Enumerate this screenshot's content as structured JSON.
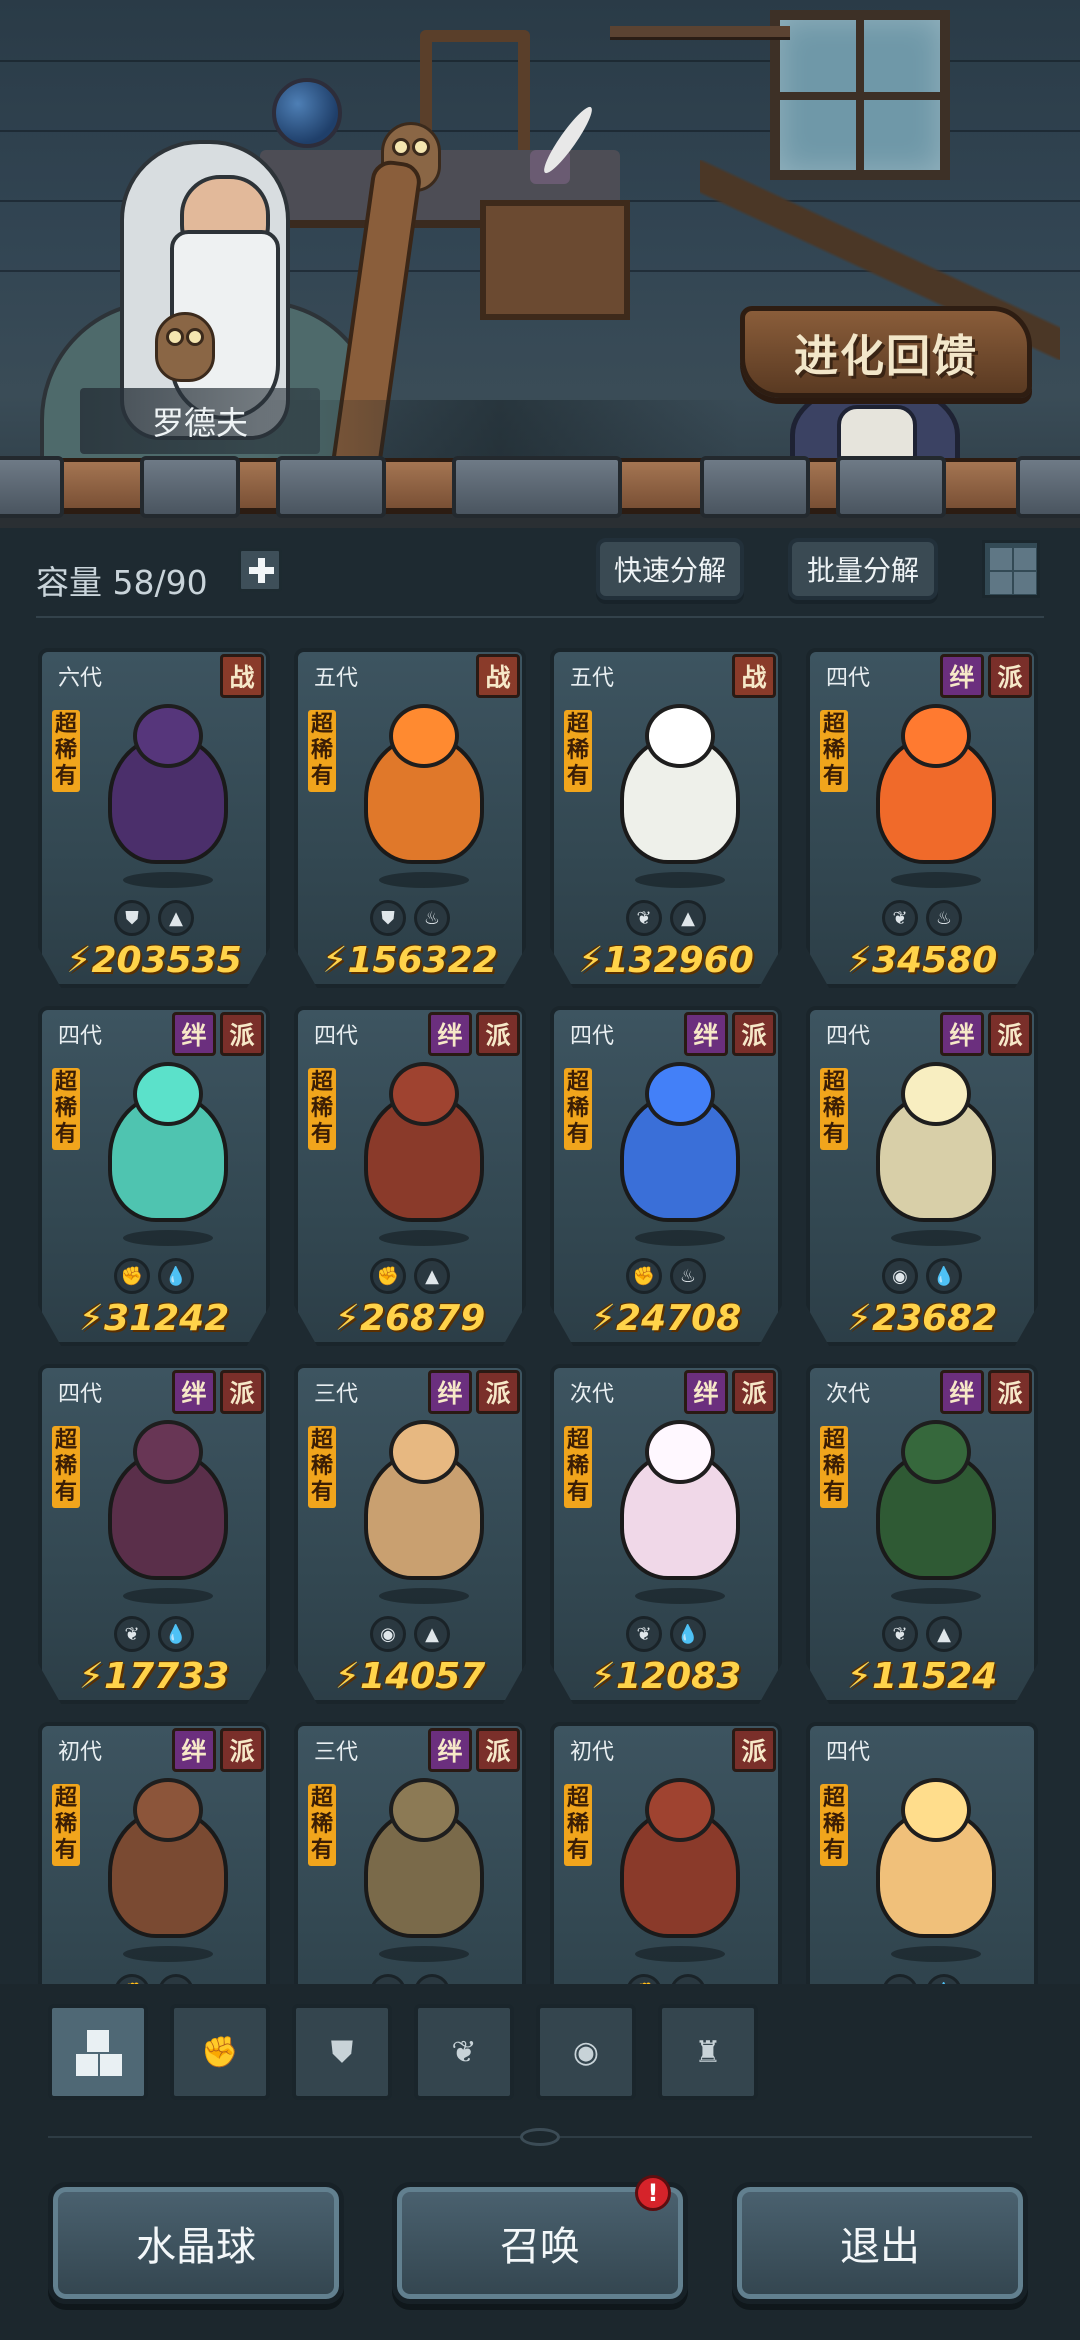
{
  "npc": {
    "name": "罗德夫"
  },
  "evolution_feedback": {
    "label": "进化回馈"
  },
  "inventory": {
    "capacity_label": "容量 58/90",
    "quick_decompose": "快速分解",
    "batch_decompose": "批量分解"
  },
  "rarity_text": [
    "超",
    "稀",
    "有"
  ],
  "cards": [
    {
      "gen": "六代",
      "tags": [
        "战"
      ],
      "power": "203535",
      "elements": [
        "shield-icon",
        "earth-icon"
      ],
      "color": "#4b2f6b"
    },
    {
      "gen": "五代",
      "tags": [
        "战"
      ],
      "power": "156322",
      "elements": [
        "shield-icon",
        "fire-icon"
      ],
      "color": "#e0782a"
    },
    {
      "gen": "五代",
      "tags": [
        "战"
      ],
      "power": "132960",
      "elements": [
        "sprout-icon",
        "earth-icon"
      ],
      "color": "#eef0ea"
    },
    {
      "gen": "四代",
      "tags": [
        "绊",
        "派"
      ],
      "power": "34580",
      "elements": [
        "sprout-icon",
        "fire-icon"
      ],
      "color": "#f06a2a"
    },
    {
      "gen": "四代",
      "tags": [
        "绊",
        "派"
      ],
      "power": "31242",
      "elements": [
        "fist-icon",
        "water-icon"
      ],
      "color": "#4fc4b0"
    },
    {
      "gen": "四代",
      "tags": [
        "绊",
        "派"
      ],
      "power": "26879",
      "elements": [
        "fist-icon",
        "earth-icon"
      ],
      "color": "#8a3a2a"
    },
    {
      "gen": "四代",
      "tags": [
        "绊",
        "派"
      ],
      "power": "24708",
      "elements": [
        "fist-icon",
        "fire-icon"
      ],
      "color": "#3a6fd8"
    },
    {
      "gen": "四代",
      "tags": [
        "绊",
        "派"
      ],
      "power": "23682",
      "elements": [
        "alien-icon",
        "water-icon"
      ],
      "color": "#d8cfa8"
    },
    {
      "gen": "四代",
      "tags": [
        "绊",
        "派"
      ],
      "power": "17733",
      "elements": [
        "sprout-icon",
        "water-icon"
      ],
      "color": "#5a2f4a"
    },
    {
      "gen": "三代",
      "tags": [
        "绊",
        "派"
      ],
      "power": "14057",
      "elements": [
        "alien-icon",
        "earth-icon"
      ],
      "color": "#c9a070"
    },
    {
      "gen": "次代",
      "tags": [
        "绊",
        "派"
      ],
      "power": "12083",
      "elements": [
        "sprout-icon",
        "water-icon"
      ],
      "color": "#f0d8e8"
    },
    {
      "gen": "次代",
      "tags": [
        "绊",
        "派"
      ],
      "power": "11524",
      "elements": [
        "sprout-icon",
        "earth-icon"
      ],
      "color": "#2f5a34"
    },
    {
      "gen": "初代",
      "tags": [
        "绊",
        "派"
      ],
      "power": "",
      "elements": [
        "fist-icon",
        "fire-icon"
      ],
      "color": "#7a4a32"
    },
    {
      "gen": "三代",
      "tags": [
        "绊",
        "派"
      ],
      "power": "",
      "elements": [
        "alien-icon",
        "fire-icon"
      ],
      "color": "#7a6a4a"
    },
    {
      "gen": "初代",
      "tags": [
        "派"
      ],
      "power": "",
      "elements": [
        "fist-icon",
        "fire-icon"
      ],
      "color": "#8a3a2a"
    },
    {
      "gen": "四代",
      "tags": [],
      "power": "",
      "elements": [
        "sprout-icon",
        "water-icon"
      ],
      "color": "#f0c07a"
    }
  ],
  "filters": [
    "all-icon",
    "fist-icon",
    "shield-icon",
    "sprout-icon",
    "alien-icon",
    "tower-icon"
  ],
  "buttons": {
    "crystal_ball": "水晶球",
    "summon": "召唤",
    "exit": "退出",
    "summon_badge": "!"
  },
  "colors": {
    "power_text": "#ffd34a",
    "rarity_badge": "#f1a51c",
    "tag_zhan": "#8a3b2a",
    "tag_ban": "#6b2f7e",
    "tag_pai": "#7a2f2a",
    "alert": "#d6232a"
  }
}
